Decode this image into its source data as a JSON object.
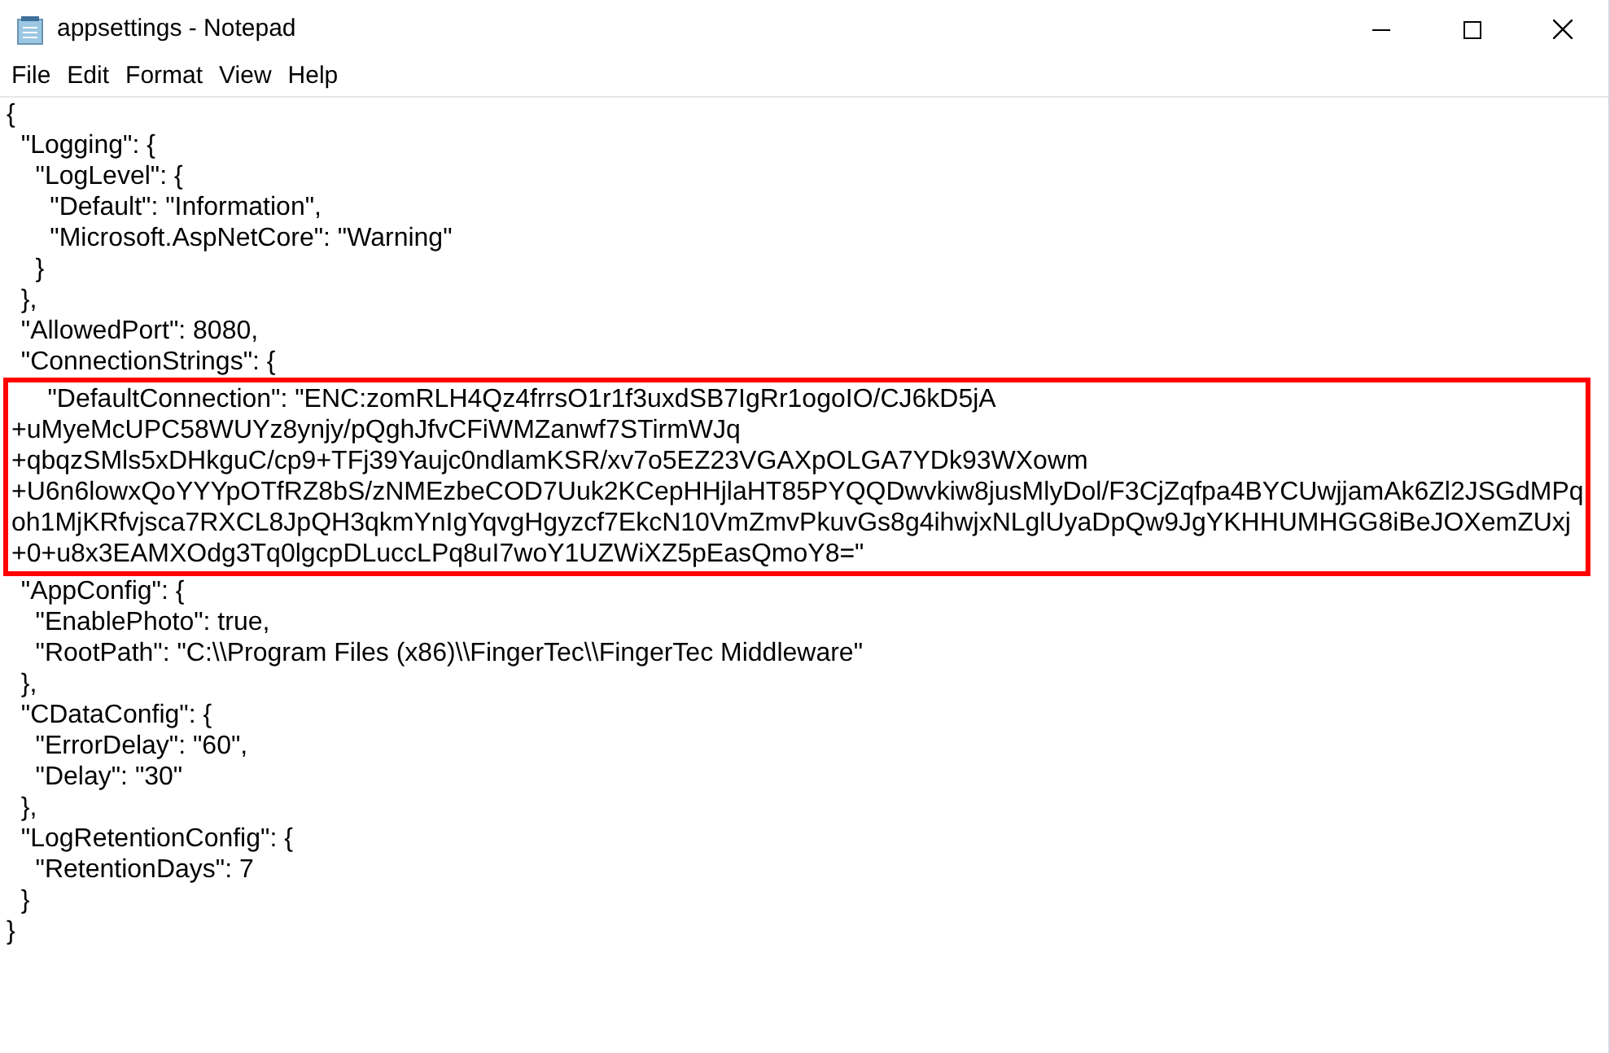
{
  "window": {
    "title": "appsettings - Notepad"
  },
  "menu": [
    "File",
    "Edit",
    "Format",
    "View",
    "Help"
  ],
  "editor": {
    "lines_before": [
      "{",
      "  \"Logging\": {",
      "    \"LogLevel\": {",
      "      \"Default\": \"Information\",",
      "      \"Microsoft.AspNetCore\": \"Warning\"",
      "    }",
      "  },",
      "  \"AllowedPort\": 8080,",
      "  \"ConnectionStrings\": {"
    ],
    "highlighted_lines": [
      "     \"DefaultConnection\": \"ENC:zomRLH4Qz4frrsO1r1f3uxdSB7IgRr1ogoIO/CJ6kD5jA",
      "+uMyeMcUPC58WUYz8ynjy/pQghJfvCFiWMZanwf7STirmWJq",
      "+qbqzSMls5xDHkguC/cp9+TFj39Yaujc0ndlamKSR/xv7o5EZ23VGAXpOLGA7YDk93WXowm",
      "+U6n6lowxQoYYYpOTfRZ8bS/zNMEzbeCOD7Uuk2KCepHHjlaHT85PYQQDwvkiw8jusMlyDol/F3CjZqfpa4BYCUwjjamAk6Zl2JSGdMPq",
      "oh1MjKRfvjsca7RXCL8JpQH3qkmYnIgYqvgHgyzcf7EkcN10VmZmvPkuvGs8g4ihwjxNLglUyaDpQw9JgYKHHUMHGG8iBeJOXemZUxj",
      "+0+u8x3EAMXOdg3Tq0lgcpDLuccLPq8uI7woY1UZWiXZ5pEasQmoY8=\""
    ],
    "lines_after": [
      "  \"AppConfig\": {",
      "    \"EnablePhoto\": true,",
      "    \"RootPath\": \"C:\\\\Program Files (x86)\\\\FingerTec\\\\FingerTec Middleware\"",
      "  },",
      "  \"CDataConfig\": {",
      "    \"ErrorDelay\": \"60\",",
      "    \"Delay\": \"30\"",
      "  },",
      "  \"LogRetentionConfig\": {",
      "    \"RetentionDays\": 7",
      "  }",
      "}"
    ]
  }
}
